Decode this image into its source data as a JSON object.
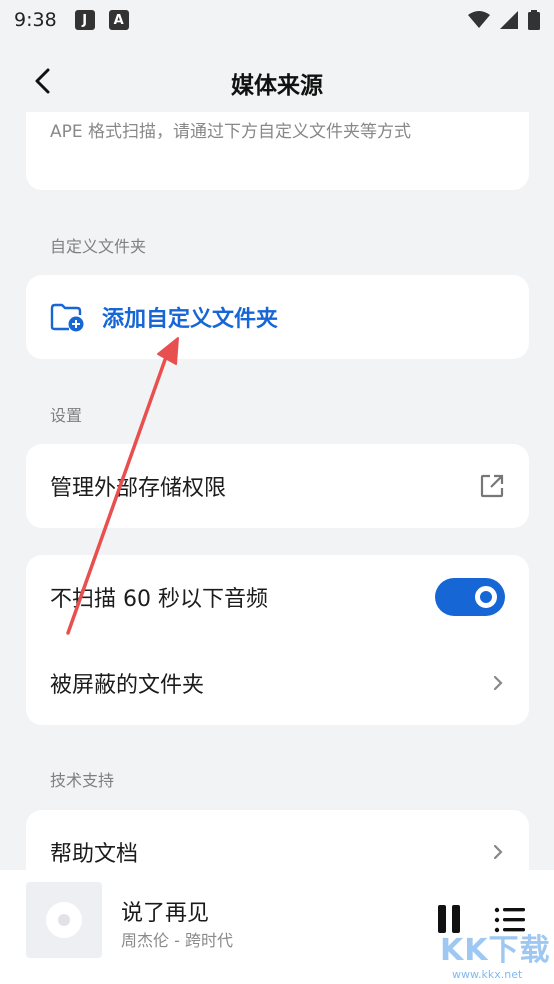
{
  "status_bar": {
    "time": "9:38",
    "notif_icons": [
      "J",
      "A"
    ],
    "icons": [
      "wifi-icon",
      "signal-icon",
      "battery-icon"
    ]
  },
  "header": {
    "title": "媒体来源",
    "back_icon": "back-arrow-icon"
  },
  "top_card": {
    "description": "APE 格式扫描，请通过下方自定义文件夹等方式"
  },
  "custom_folder": {
    "section_label": "自定义文件夹",
    "add_label": "添加自定义文件夹",
    "icon": "folder-add-icon"
  },
  "settings": {
    "section_label": "设置",
    "external_storage_label": "管理外部存储权限",
    "external_icon": "open-external-icon",
    "skip_short_label": "不扫描 60 秒以下音频",
    "skip_short_enabled": true,
    "blocked_folders_label": "被屏蔽的文件夹"
  },
  "support": {
    "section_label": "技术支持",
    "help_label": "帮助文档"
  },
  "player": {
    "song_title": "说了再见",
    "artist_album": "周杰伦 - 跨时代",
    "state": "playing"
  },
  "watermark": {
    "text": "KK下载",
    "url": "www.kkx.net"
  },
  "colors": {
    "accent": "#1766d6",
    "background": "#f2f3f5",
    "card": "#ffffff",
    "annotation_arrow": "#e8504f"
  }
}
